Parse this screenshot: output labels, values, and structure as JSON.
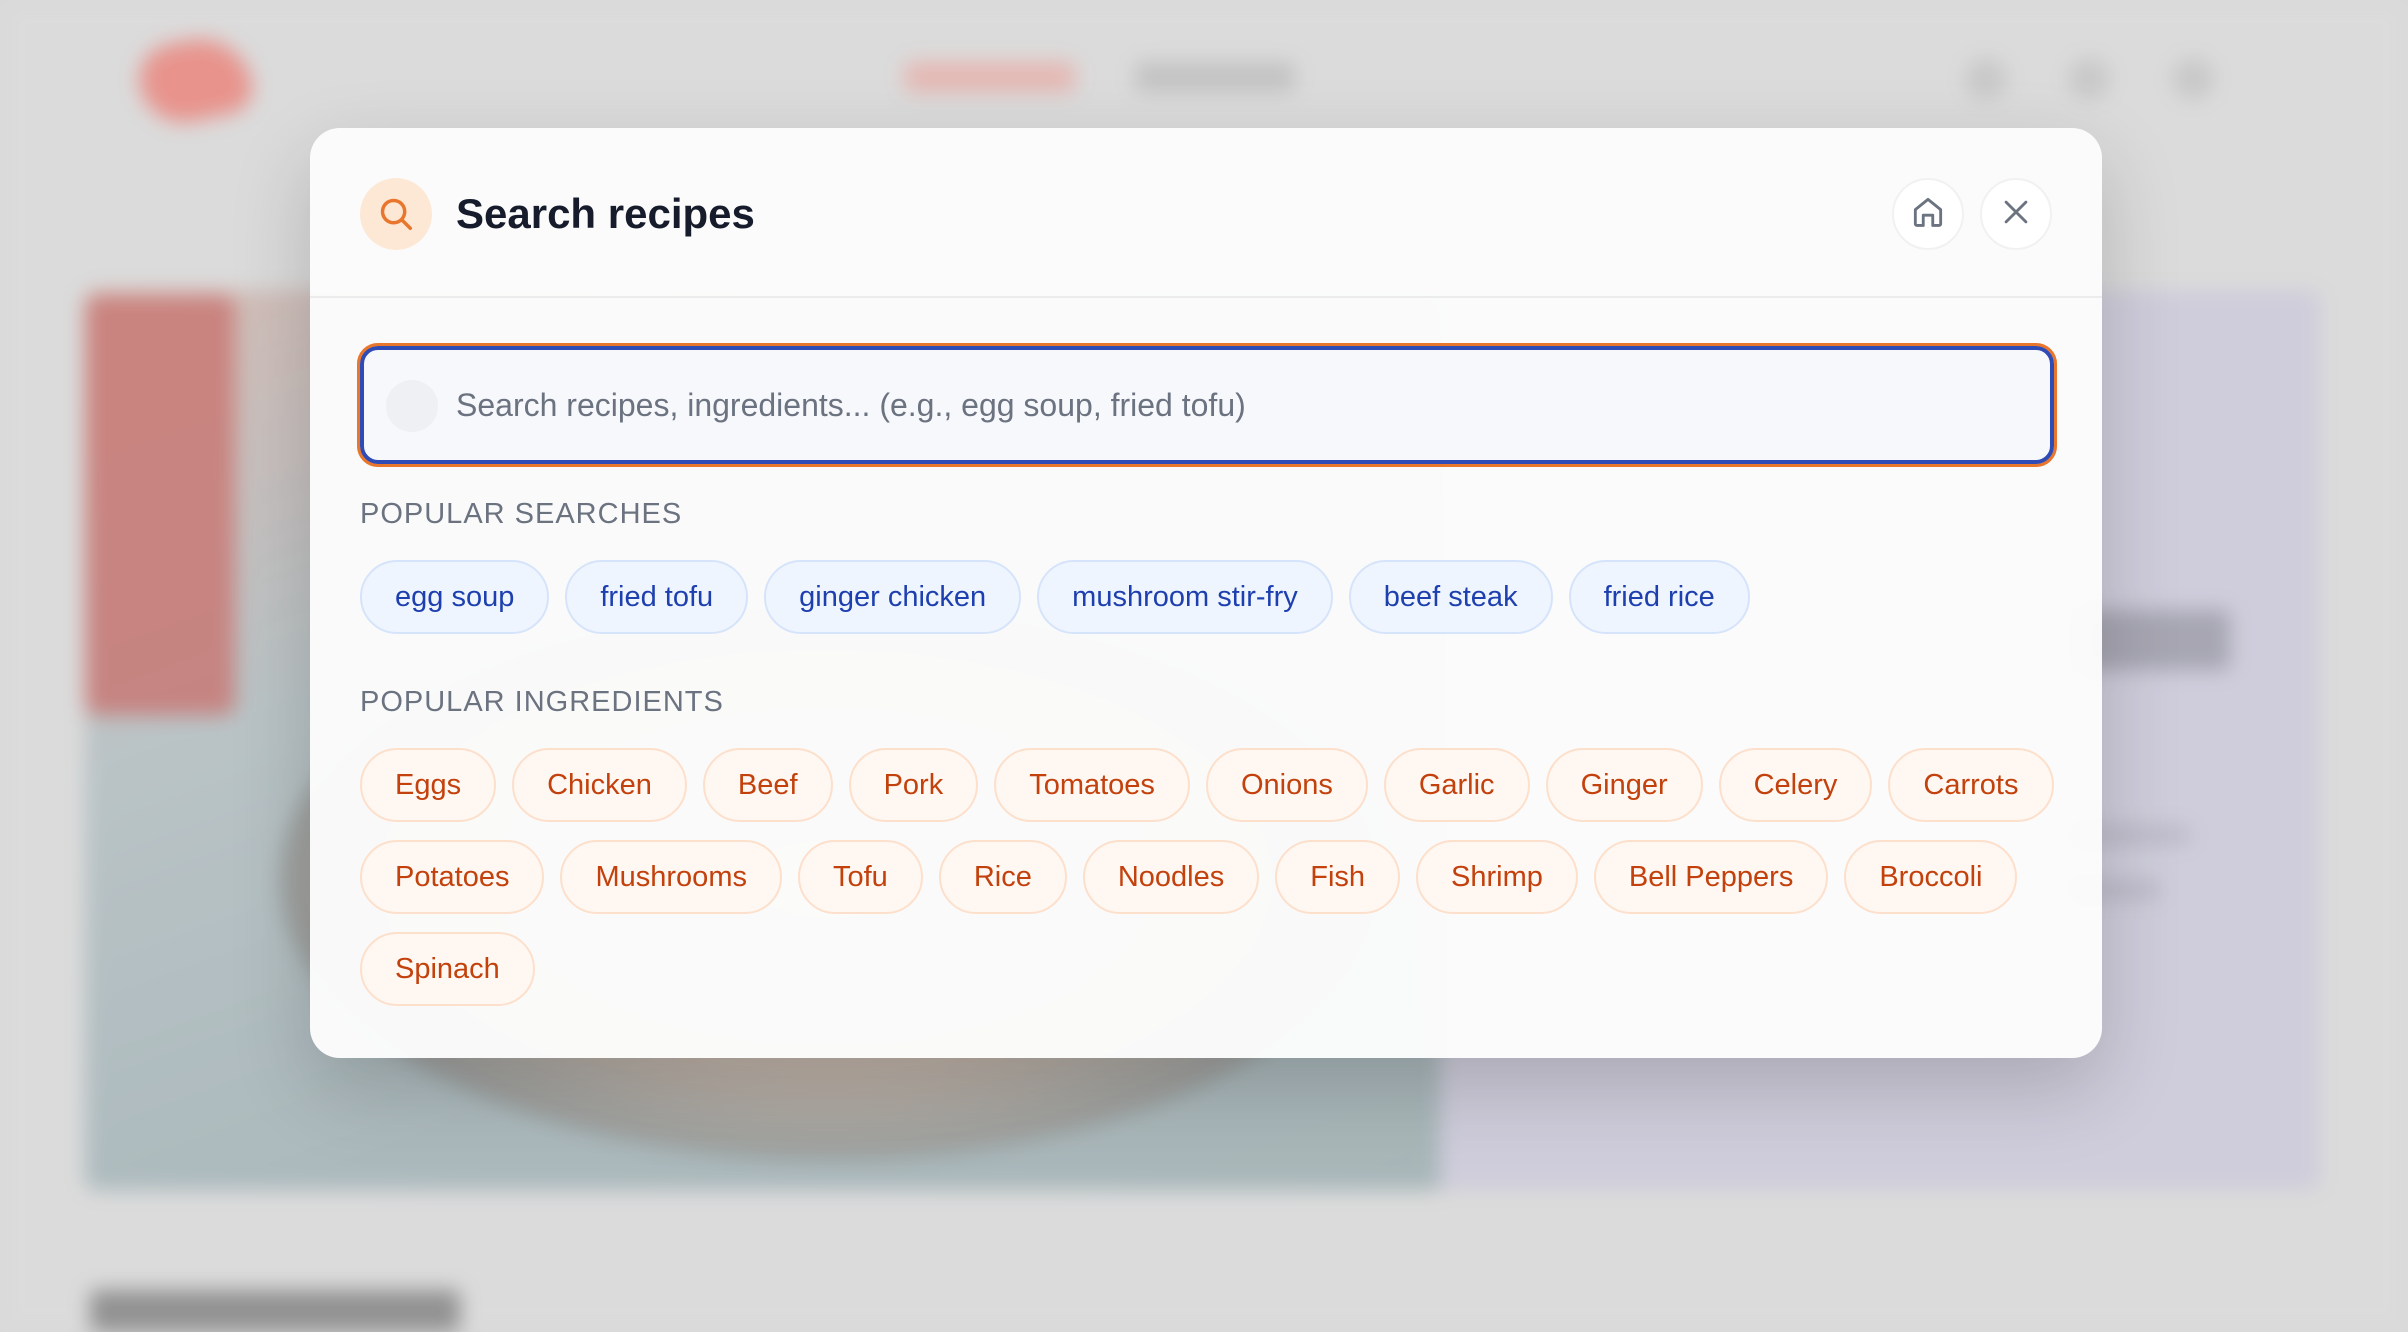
{
  "modal": {
    "title": "Search recipes",
    "search": {
      "placeholder": "Search recipes, ingredients... (e.g., egg soup, fried tofu)",
      "value": ""
    },
    "popular_searches_label": "POPULAR SEARCHES",
    "popular_searches": [
      "egg soup",
      "fried tofu",
      "ginger chicken",
      "mushroom stir-fry",
      "beef steak",
      "fried rice"
    ],
    "popular_ingredients_label": "POPULAR INGREDIENTS",
    "popular_ingredients": [
      "Eggs",
      "Chicken",
      "Beef",
      "Pork",
      "Tomatoes",
      "Onions",
      "Garlic",
      "Ginger",
      "Celery",
      "Carrots",
      "Potatoes",
      "Mushrooms",
      "Tofu",
      "Rice",
      "Noodles",
      "Fish",
      "Shrimp",
      "Bell Peppers",
      "Broccoli",
      "Spinach"
    ],
    "icons": {
      "header": "search-icon",
      "home": "home-icon",
      "close": "close-icon"
    }
  },
  "colors": {
    "accent_orange": "#e8762d",
    "focus_blue": "#2f4bb5",
    "search_chip_text": "#1e40af",
    "ingredient_chip_text": "#c2410c",
    "title_text": "#161c2b"
  }
}
